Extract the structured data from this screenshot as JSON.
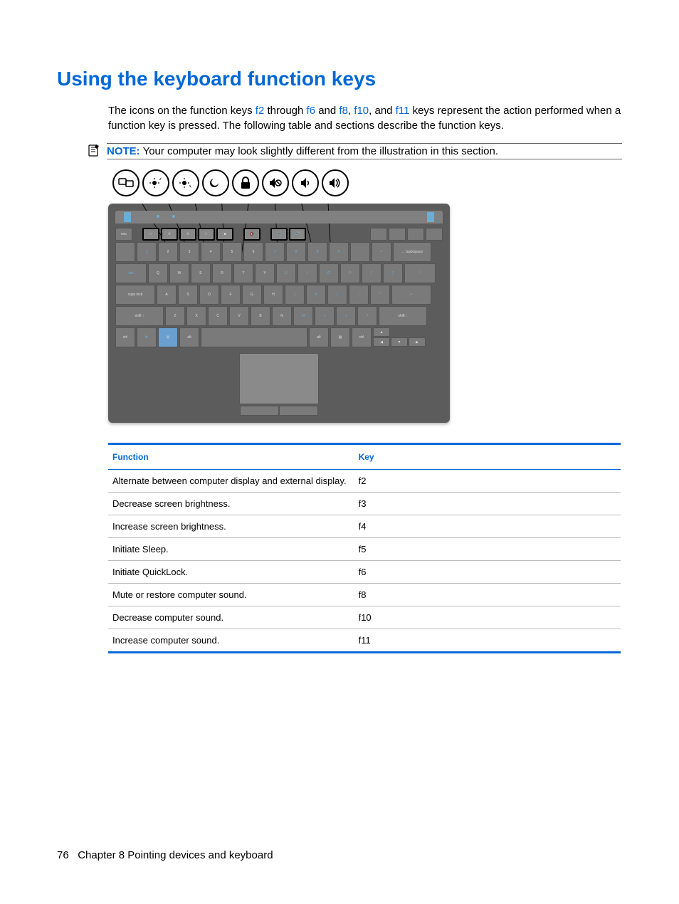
{
  "heading": "Using the keyboard function keys",
  "intro": {
    "prefix": "The icons on the function keys ",
    "k1": "f2",
    "t1": " through ",
    "k2": "f6",
    "t2": " and ",
    "k3": "f8",
    "t3": ", ",
    "k4": "f10",
    "t4": ", and ",
    "k5": "f11",
    "suffix": " keys represent the action performed when a function key is pressed. The following table and sections describe the function keys."
  },
  "note": {
    "label": "NOTE:",
    "text": "Your computer may look slightly different from the illustration in this section."
  },
  "table": {
    "headers": {
      "function": "Function",
      "key": "Key"
    },
    "rows": [
      {
        "function": "Alternate between computer display and external display.",
        "key": "f2"
      },
      {
        "function": "Decrease screen brightness.",
        "key": "f3"
      },
      {
        "function": "Increase screen brightness.",
        "key": "f4"
      },
      {
        "function": "Initiate Sleep.",
        "key": "f5"
      },
      {
        "function": "Initiate QuickLock.",
        "key": "f6"
      },
      {
        "function": "Mute or restore computer sound.",
        "key": "f8"
      },
      {
        "function": "Decrease computer sound.",
        "key": "f10"
      },
      {
        "function": "Increase computer sound.",
        "key": "f11"
      }
    ]
  },
  "footer": {
    "page": "76",
    "chapter": "Chapter 8   Pointing devices and keyboard"
  },
  "chart_data": {
    "type": "table",
    "title": "Function key reference",
    "columns": [
      "Function",
      "Key"
    ],
    "rows": [
      [
        "Alternate between computer display and external display.",
        "f2"
      ],
      [
        "Decrease screen brightness.",
        "f3"
      ],
      [
        "Increase screen brightness.",
        "f4"
      ],
      [
        "Initiate Sleep.",
        "f5"
      ],
      [
        "Initiate QuickLock.",
        "f6"
      ],
      [
        "Mute or restore computer sound.",
        "f8"
      ],
      [
        "Decrease computer sound.",
        "f10"
      ],
      [
        "Increase computer sound.",
        "f11"
      ]
    ]
  }
}
